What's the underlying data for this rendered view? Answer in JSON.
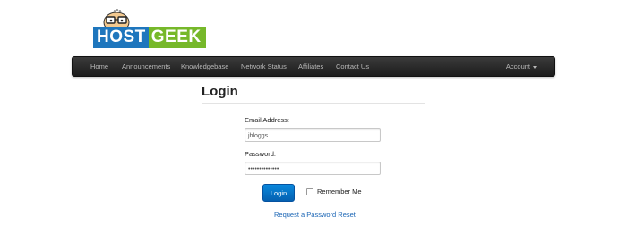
{
  "logo": {
    "part1": "HOST",
    "part2": "GEEK"
  },
  "nav": {
    "items": [
      "Home",
      "Announcements",
      "Knowledgebase",
      "Network Status",
      "Affiliates",
      "Contact Us"
    ],
    "account": "Account"
  },
  "login": {
    "title": "Login",
    "email_label": "Email Address:",
    "email_value": "jbloggs",
    "password_label": "Password:",
    "password_value": "••••••••••••••",
    "submit_label": "Login",
    "remember_label": "Remember Me",
    "remember_checked": false,
    "reset_link": "Request a Password Reset"
  },
  "colors": {
    "brand_blue": "#1e76bd",
    "brand_green": "#76b82a",
    "navbar": "#2a2a2a",
    "button": "#0a75cc",
    "link": "#1a65b5"
  }
}
